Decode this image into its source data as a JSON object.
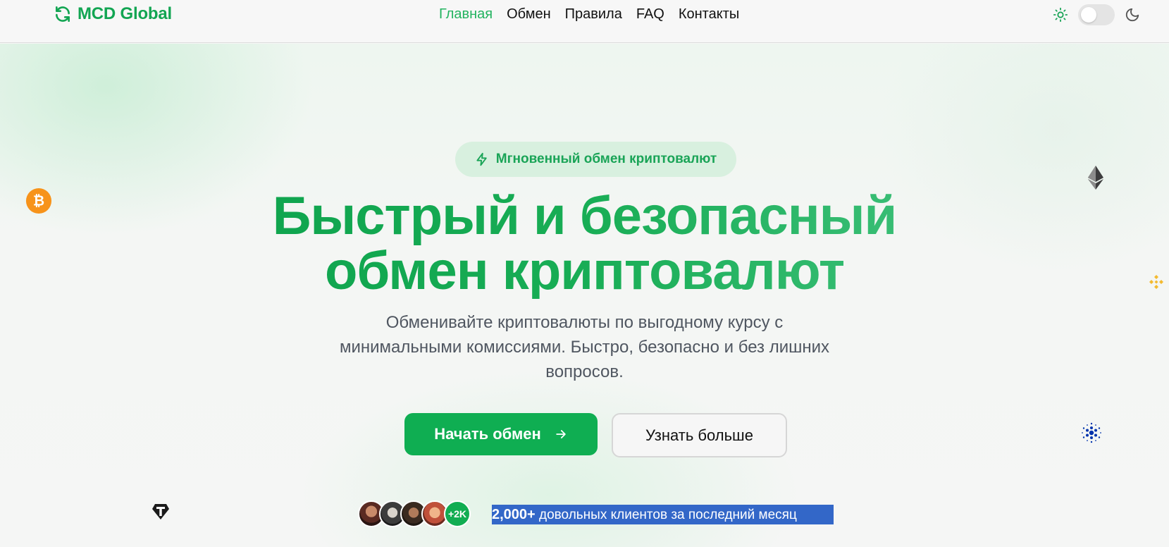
{
  "header": {
    "brand": "MCD Global",
    "nav": [
      {
        "label": "Главная",
        "active": true
      },
      {
        "label": "Обмен",
        "active": false
      },
      {
        "label": "Правила",
        "active": false
      },
      {
        "label": "FAQ",
        "active": false
      },
      {
        "label": "Контакты",
        "active": false
      }
    ],
    "theme_toggle": {
      "sun_icon": "sun-icon",
      "moon_icon": "moon-icon",
      "state": "light"
    }
  },
  "hero": {
    "badge": "Мгновенный обмен криптовалют",
    "headline_line1": "Быстрый и безопасный",
    "headline_line2": "обмен криптовалют",
    "subtitle": "Обменивайте криптовалюты по выгодному курсу с минимальными комиссиями. Быстро, безопасно и без лишних вопросов.",
    "primary_button": "Начать обмен",
    "secondary_button": "Узнать больше",
    "avatars_more": "+2K",
    "clients_count": "2,000+",
    "clients_text": " довольных клиентов за последний месяц"
  },
  "floating_coins": [
    "bitcoin-icon",
    "ethereum-icon",
    "binance-icon",
    "cardano-icon",
    "tether-icon"
  ],
  "colors": {
    "accent": "#12a552",
    "button": "#0fae52",
    "badge_bg": "#d8f0df",
    "selection": "#3367c8"
  }
}
